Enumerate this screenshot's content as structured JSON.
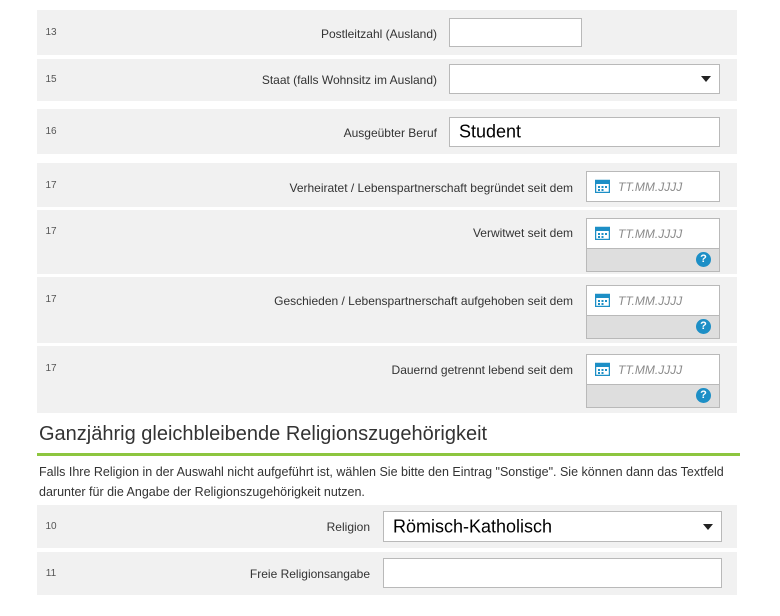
{
  "rows": [
    {
      "num": "13",
      "label": "Postleitzahl (Ausland)",
      "value": ""
    },
    {
      "num": "15",
      "label": "Staat (falls Wohnsitz im Ausland)",
      "value": ""
    },
    {
      "num": "16",
      "label": "Ausgeübter Beruf",
      "value": "Student"
    },
    {
      "num": "17",
      "label": "Verheiratet / Lebenspartnerschaft begründet seit dem",
      "placeholder": "TT.MM.JJJJ"
    },
    {
      "num": "17",
      "label": "Verwitwet seit dem",
      "placeholder": "TT.MM.JJJJ"
    },
    {
      "num": "17",
      "label": "Geschieden / Lebenspartnerschaft aufgehoben seit dem",
      "placeholder": "TT.MM.JJJJ"
    },
    {
      "num": "17",
      "label": "Dauernd getrennt lebend seit dem",
      "placeholder": "TT.MM.JJJJ"
    }
  ],
  "religion_section": {
    "title": "Ganzjährig gleichbleibende Religionszugehörigkeit",
    "description": "Falls Ihre Religion in der Auswahl nicht aufgeführt ist, wählen Sie bitte den Eintrag \"Sonstige\". Sie können dann das Textfeld darunter für die Angabe der Religionszugehörigkeit nutzen.",
    "religion": {
      "num": "10",
      "label": "Religion",
      "value": "Römisch-Katholisch"
    },
    "free": {
      "num": "11",
      "label": "Freie Religionsangabe",
      "value": ""
    }
  },
  "help_glyph": "?",
  "colors": {
    "row_bg": "#f1f1f1",
    "accent_line": "#8dc63f",
    "icon_blue": "#1d8fc6"
  },
  "icons": {
    "date": "calendar-icon",
    "help": "help-icon",
    "dropdown": "chevron-down-icon"
  }
}
